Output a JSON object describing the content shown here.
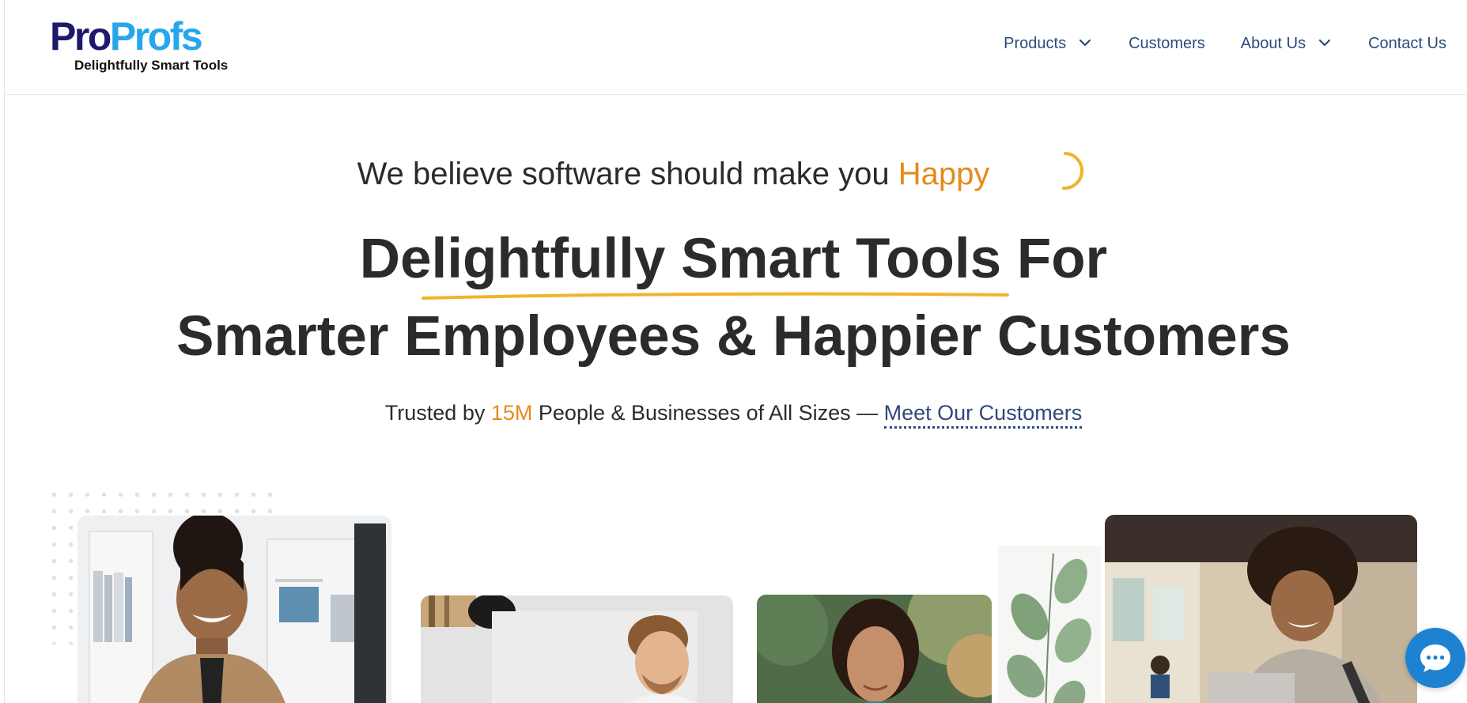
{
  "header": {
    "logo": {
      "word_part1": "Pro",
      "word_part2": "Profs",
      "tagline": "Delightfully Smart Tools"
    },
    "nav": [
      {
        "label": "Products",
        "has_dropdown": true
      },
      {
        "label": "Customers",
        "has_dropdown": false
      },
      {
        "label": "About Us",
        "has_dropdown": true
      },
      {
        "label": "Contact Us",
        "has_dropdown": false
      }
    ]
  },
  "hero": {
    "tagline_prefix": "We believe software should make you",
    "tagline_highlight": "Happy",
    "headline_line1": "Delightfully Smart Tools For",
    "headline_line2": "Smarter Employees & Happier Customers",
    "trusted_prefix": "Trusted by",
    "trusted_number": "15M",
    "trusted_suffix": "People & Businesses of All Sizes —",
    "trusted_link": "Meet Our Customers"
  },
  "icons": {
    "nav_dropdown": "chevron-down-icon",
    "chat": "chat-bubble-icon",
    "loading": "loading-spinner-icon"
  },
  "colors": {
    "brand_dark": "#1d1a6d",
    "brand_light": "#27a6ec",
    "nav_text": "#2e4a7d",
    "accent": "#e6891a",
    "chat_button": "#1e82d2"
  }
}
